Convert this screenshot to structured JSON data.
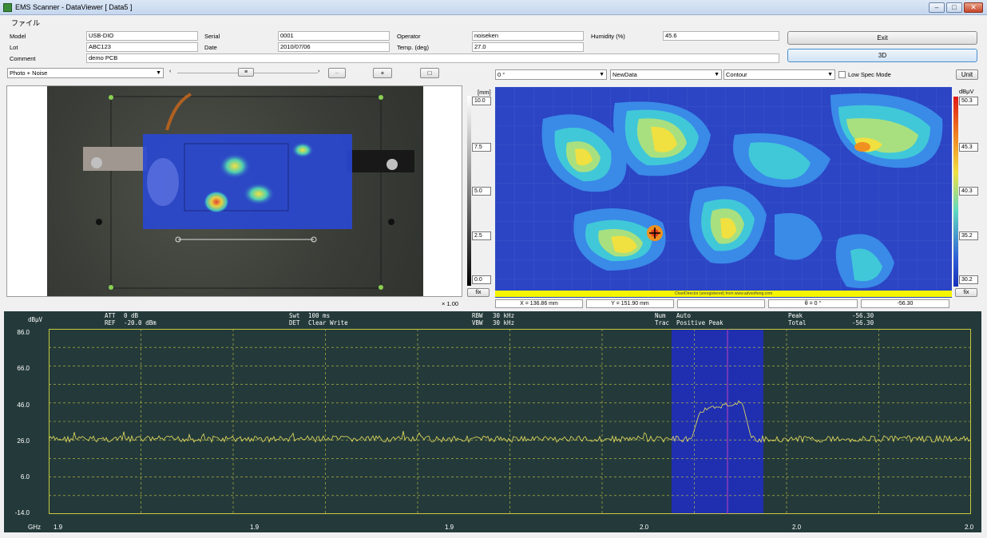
{
  "window": {
    "title": "EMS Scanner - DataViewer   [ Data5 ]"
  },
  "menu": {
    "file": "ファイル"
  },
  "info": {
    "model_label": "Model",
    "model_value": "USB-DIO",
    "serial_label": "Serial",
    "serial_value": "0001",
    "operator_label": "Operator",
    "operator_value": "noiseken",
    "humidity_label": "Humidity (%)",
    "humidity_value": "45.6",
    "lot_label": "Lot",
    "lot_value": "ABC123",
    "date_label": "Date",
    "date_value": "2010/07/06",
    "temp_label": "Temp. (deg)",
    "temp_value": "27.0",
    "comment_label": "Comment",
    "comment_value": "demo PCB"
  },
  "buttons": {
    "exit": "Exit",
    "three_d": "3D",
    "unit": "Unit",
    "fix_left": "fix",
    "fix_right": "fix",
    "plus": "+",
    "square": "□",
    "slider_thumb": "≡"
  },
  "left_toolbar": {
    "view_mode": "Photo + Noise",
    "zoom": "× 1.00"
  },
  "right_toolbar": {
    "angle": "0 °",
    "dataset": "NewData",
    "plot_type": "Contour",
    "low_spec_label": "Low Spec Mode"
  },
  "contour": {
    "y_unit": "[mm]",
    "y_ticks": [
      "10.0",
      "7.5",
      "5.0",
      "2.5",
      "0.0"
    ],
    "z_unit": "dBμV",
    "z_ticks": [
      "50.3",
      "45.3",
      "40.3",
      "35.2",
      "30.2"
    ],
    "credit": "ChartDirector (unregistered) from www.advsofteng.com"
  },
  "status": {
    "x": "X = 136.86 mm",
    "y": "Y = 151.90 mm",
    "empty": "",
    "theta": "θ = 0 °",
    "value": "-56.30"
  },
  "spectrum": {
    "y_unit": "dBμV",
    "att_label": "ATT",
    "att_value": "0 dB",
    "ref_label": "REF",
    "ref_value": "-20.0 dBm",
    "swt_label": "Swt",
    "swt_value": "100 ms",
    "det_label": "DET",
    "det_value": "Clear Write",
    "rbw_label": "RBW",
    "rbw_value": "30 kHz",
    "vbw_label": "VBW",
    "vbw_value": "30 kHz",
    "num_label": "Num",
    "num_value": "Auto",
    "trac_label": "Trac",
    "trac_value": "Positive Peak",
    "peak_label": "Peak",
    "peak_value": "-56.30",
    "total_label": "Total",
    "total_value": "-56.30",
    "y_ticks": [
      "86.0",
      "66.0",
      "46.0",
      "26.0",
      "6.0",
      "-14.0"
    ],
    "x_unit": "GHz",
    "x_ticks": [
      "1.9",
      "1.9",
      "1.9",
      "2.0",
      "2.0",
      "2.0"
    ]
  },
  "colors": {
    "spectrum_bg": "#243a3a",
    "trace": "#e8e060",
    "grid": "#c8c840",
    "band": "#1f2fb0",
    "marker": "#c040c0"
  }
}
